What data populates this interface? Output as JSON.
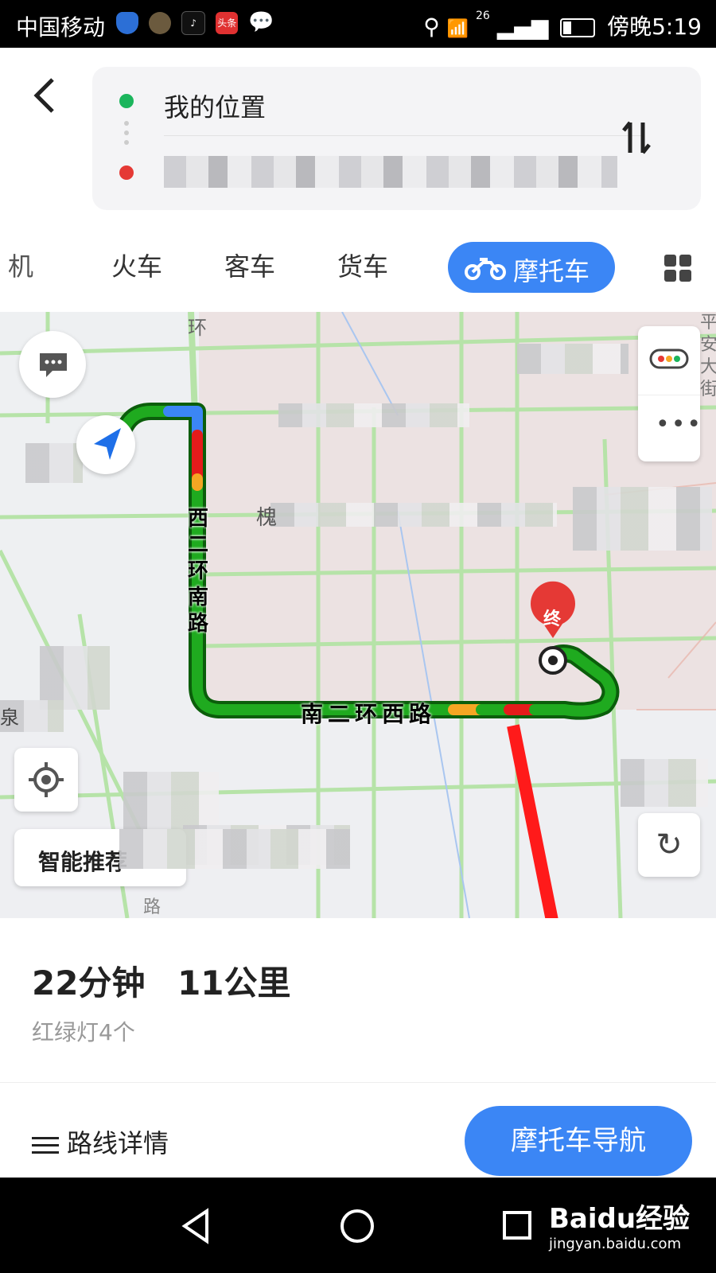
{
  "status_bar": {
    "carrier": "中国移动",
    "signal_label": "26",
    "time": "傍晚5:19",
    "app_icons": [
      "shield-icon",
      "clock-icon",
      "tiktok-icon",
      "toutiao-icon",
      "chat-bubble-icon"
    ],
    "toutiao_label": "头条"
  },
  "header": {
    "start_label": "我的位置",
    "destination": ""
  },
  "tabs": {
    "items": [
      "飞机",
      "火车",
      "客车",
      "货车"
    ],
    "active": "摩托车",
    "partial_first": "机"
  },
  "map": {
    "route_labels": [
      "西二环南路",
      "南二环西路"
    ],
    "end_marker": "终",
    "map_texts": [
      "环",
      "槐",
      "泉",
      "路"
    ],
    "recommend_label": "智能推荐",
    "road_side_text": "平安大街"
  },
  "route": {
    "duration": "22分钟",
    "distance": "11公里",
    "traffic_lights": "红绿灯4个",
    "details_label": "路线详情",
    "nav_button": "摩托车导航"
  },
  "watermark": {
    "brand": "Baidu经验",
    "url": "jingyan.baidu.com"
  },
  "colors": {
    "accent": "#3b86f5",
    "route_green": "#1faa1f",
    "route_red": "#e51b1b",
    "route_yellow": "#f5a623",
    "arrow_red": "#ff1a1a"
  }
}
